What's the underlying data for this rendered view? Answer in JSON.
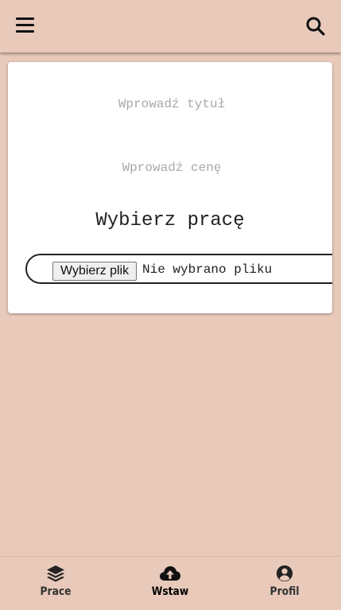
{
  "topbar": {
    "menu_icon": "hamburger-menu-icon",
    "search_icon": "search-icon"
  },
  "form": {
    "title_placeholder": "Wprowadź tytuł",
    "price_placeholder": "Wprowadź cenę",
    "choose_heading": "Wybierz pracę",
    "file_button_label": "Wybierz plik",
    "file_status": "Nie wybrano pliku"
  },
  "nav": {
    "items": [
      {
        "label": "Prace",
        "icon": "layers-icon"
      },
      {
        "label": "Wstaw",
        "icon": "cloud-upload-icon",
        "active": true
      },
      {
        "label": "Profil",
        "icon": "user-circle-icon"
      }
    ]
  },
  "colors": {
    "background": "#e8c9ba",
    "card": "#ffffff",
    "text": "#222222"
  }
}
